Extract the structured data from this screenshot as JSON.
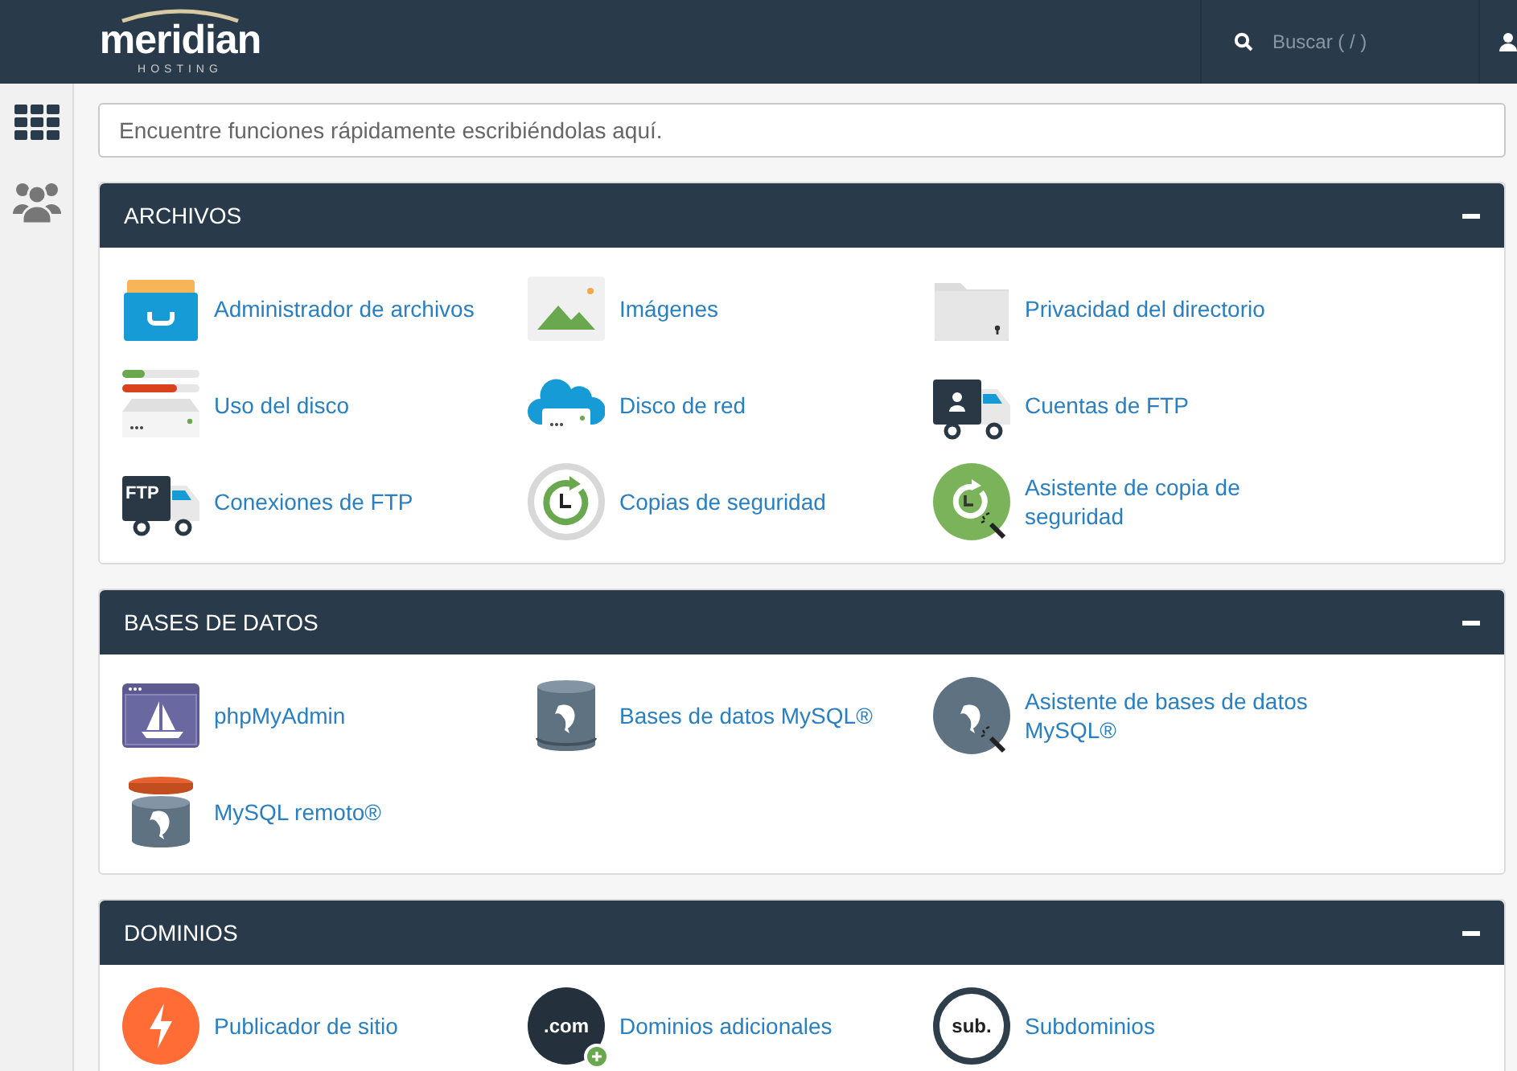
{
  "header": {
    "logo": {
      "name": "meridian",
      "tagline": "HOSTING"
    },
    "search": {
      "placeholder": "Buscar ( / )"
    }
  },
  "quick_search": {
    "placeholder": "Encuentre funciones rápidamente escribiéndolas aquí."
  },
  "sections": [
    {
      "title": "ARCHIVOS",
      "expanded": true,
      "items": [
        {
          "label": "Administrador de archivos",
          "kind": "file-manager"
        },
        {
          "label": "Imágenes",
          "kind": "images"
        },
        {
          "label": "Privacidad del directorio",
          "kind": "folder-lock"
        },
        {
          "label": "Uso del disco",
          "kind": "disk-usage"
        },
        {
          "label": "Disco de red",
          "kind": "cloud-disk"
        },
        {
          "label": "Cuentas de FTP",
          "kind": "ftp-accounts"
        },
        {
          "label": "Conexiones de FTP",
          "kind": "ftp-truck",
          "badge": "FTP"
        },
        {
          "label": "Copias de seguridad",
          "kind": "backup"
        },
        {
          "label": "Asistente de copia de seguridad",
          "kind": "backup-wizard"
        }
      ]
    },
    {
      "title": "BASES DE DATOS",
      "expanded": true,
      "items": [
        {
          "label": "phpMyAdmin",
          "kind": "phpmyadmin"
        },
        {
          "label": "Bases de datos MySQL®",
          "kind": "database"
        },
        {
          "label": "Asistente de bases de datos MySQL®",
          "kind": "database-wizard"
        },
        {
          "label": "MySQL remoto®",
          "kind": "remote-database"
        }
      ]
    },
    {
      "title": "DOMINIOS",
      "expanded": true,
      "items": [
        {
          "label": "Publicador de sitio",
          "kind": "publisher"
        },
        {
          "label": "Dominios adicionales",
          "kind": "addon-domain",
          "badge": ".com"
        },
        {
          "label": "Subdominios",
          "kind": "subdomain",
          "badge": "sub."
        }
      ]
    }
  ]
}
